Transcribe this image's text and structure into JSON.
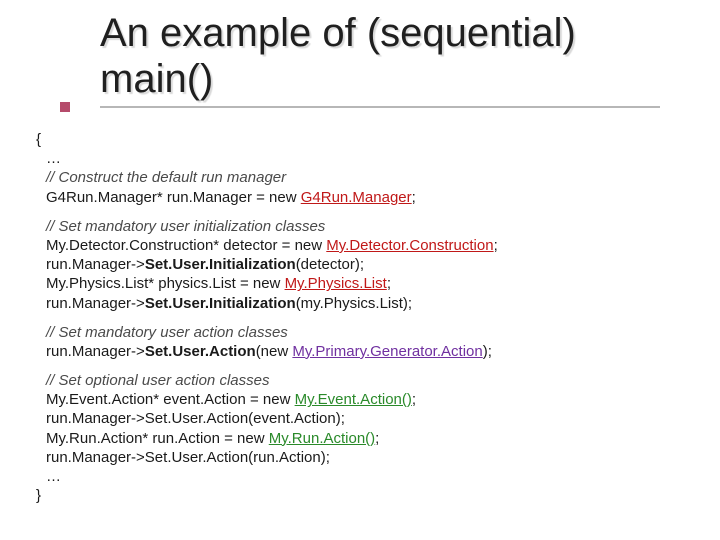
{
  "title_line1": "An example of (sequential)",
  "title_line2": "main()",
  "open_brace": "{",
  "ellipsis_top": "…",
  "c1": "// Construct the default run manager",
  "l1_a": "G4Run.Manager* run.Manager = new ",
  "l1_kw": "G4Run.Manager",
  "l1_b": ";",
  "c2": "// Set mandatory user initialization classes",
  "l2_a": "My.Detector.Construction* detector = new ",
  "l2_kw": "My.Detector.Construction",
  "l2_b": ";",
  "l3_a": "run.Manager->",
  "l3_fn": "Set.User.Initialization",
  "l3_b": "(detector);",
  "l4_a": "My.Physics.List* physics.List = new ",
  "l4_kw": "My.Physics.List",
  "l4_b": ";",
  "l5_a": "run.Manager->",
  "l5_fn": "Set.User.Initialization",
  "l5_b": "(my.Physics.List);",
  "c3": "// Set mandatory user action classes",
  "l6_a": "run.Manager->",
  "l6_fn": "Set.User.Action",
  "l6_b": "(new ",
  "l6_kw": "My.Primary.Generator.Action",
  "l6_c": ");",
  "c4": "// Set optional user action classes",
  "l7_a": "My.Event.Action* event.Action = new ",
  "l7_kw": "My.Event.Action()",
  "l7_b": ";",
  "l8_a": " run.Manager->Set.User.Action(event.Action);",
  "l9_a": "My.Run.Action* run.Action = new ",
  "l9_kw": "My.Run.Action()",
  "l9_b": ";",
  "l10_a": "run.Manager->Set.User.Action(run.Action);",
  "ellipsis_bot": "…",
  "close_brace": "}"
}
